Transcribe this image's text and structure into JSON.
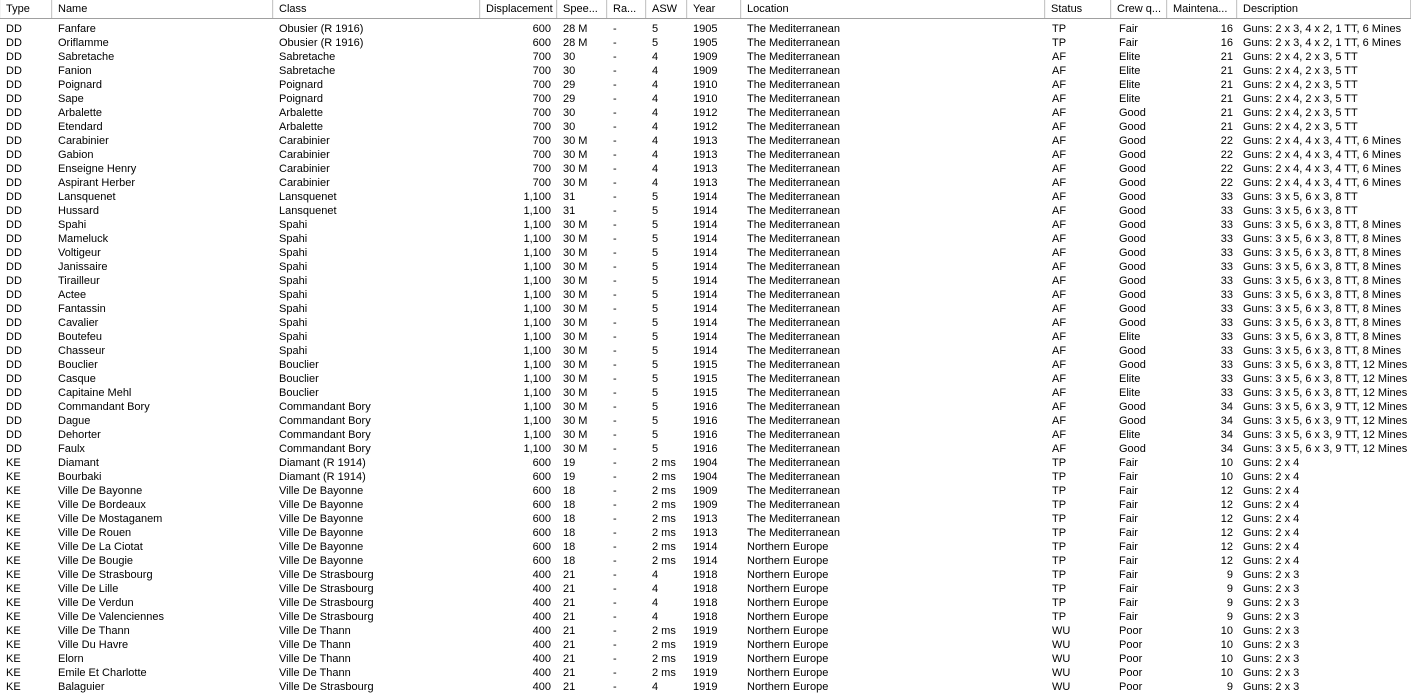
{
  "columns": [
    "Type",
    "Name",
    "Class",
    "Displacement",
    "Spee...",
    "Ra...",
    "ASW",
    "Year",
    "Location",
    "Status",
    "Crew q...",
    "Maintena...",
    "Description"
  ],
  "rows": [
    [
      "DD",
      "Fanfare",
      "Obusier (R 1916)",
      "600",
      "28 M",
      "-",
      "5",
      "1905",
      "The Mediterranean",
      "TP",
      "Fair",
      "16",
      "Guns: 2 x 3, 4 x 2, 1 TT, 6 Mines"
    ],
    [
      "DD",
      "Oriflamme",
      "Obusier (R 1916)",
      "600",
      "28 M",
      "-",
      "5",
      "1905",
      "The Mediterranean",
      "TP",
      "Fair",
      "16",
      "Guns: 2 x 3, 4 x 2, 1 TT, 6 Mines"
    ],
    [
      "DD",
      "Sabretache",
      "Sabretache",
      "700",
      "30",
      "-",
      "4",
      "1909",
      "The Mediterranean",
      "AF",
      "Elite",
      "21",
      "Guns: 2 x 4, 2 x 3, 5 TT"
    ],
    [
      "DD",
      "Fanion",
      "Sabretache",
      "700",
      "30",
      "-",
      "4",
      "1909",
      "The Mediterranean",
      "AF",
      "Elite",
      "21",
      "Guns: 2 x 4, 2 x 3, 5 TT"
    ],
    [
      "DD",
      "Poignard",
      "Poignard",
      "700",
      "29",
      "-",
      "4",
      "1910",
      "The Mediterranean",
      "AF",
      "Elite",
      "21",
      "Guns: 2 x 4, 2 x 3, 5 TT"
    ],
    [
      "DD",
      "Sape",
      "Poignard",
      "700",
      "29",
      "-",
      "4",
      "1910",
      "The Mediterranean",
      "AF",
      "Elite",
      "21",
      "Guns: 2 x 4, 2 x 3, 5 TT"
    ],
    [
      "DD",
      "Arbalette",
      "Arbalette",
      "700",
      "30",
      "-",
      "4",
      "1912",
      "The Mediterranean",
      "AF",
      "Good",
      "21",
      "Guns: 2 x 4, 2 x 3, 5 TT"
    ],
    [
      "DD",
      "Etendard",
      "Arbalette",
      "700",
      "30",
      "-",
      "4",
      "1912",
      "The Mediterranean",
      "AF",
      "Good",
      "21",
      "Guns: 2 x 4, 2 x 3, 5 TT"
    ],
    [
      "DD",
      "Carabinier",
      "Carabinier",
      "700",
      "30 M",
      "-",
      "4",
      "1913",
      "The Mediterranean",
      "AF",
      "Good",
      "22",
      "Guns: 2 x 4, 4 x 3, 4 TT, 6 Mines"
    ],
    [
      "DD",
      "Gabion",
      "Carabinier",
      "700",
      "30 M",
      "-",
      "4",
      "1913",
      "The Mediterranean",
      "AF",
      "Good",
      "22",
      "Guns: 2 x 4, 4 x 3, 4 TT, 6 Mines"
    ],
    [
      "DD",
      "Enseigne Henry",
      "Carabinier",
      "700",
      "30 M",
      "-",
      "4",
      "1913",
      "The Mediterranean",
      "AF",
      "Good",
      "22",
      "Guns: 2 x 4, 4 x 3, 4 TT, 6 Mines"
    ],
    [
      "DD",
      "Aspirant Herber",
      "Carabinier",
      "700",
      "30 M",
      "-",
      "4",
      "1913",
      "The Mediterranean",
      "AF",
      "Good",
      "22",
      "Guns: 2 x 4, 4 x 3, 4 TT, 6 Mines"
    ],
    [
      "DD",
      "Lansquenet",
      "Lansquenet",
      "1,100",
      "31",
      "-",
      "5",
      "1914",
      "The Mediterranean",
      "AF",
      "Good",
      "33",
      "Guns: 3 x 5, 6 x 3, 8 TT"
    ],
    [
      "DD",
      "Hussard",
      "Lansquenet",
      "1,100",
      "31",
      "-",
      "5",
      "1914",
      "The Mediterranean",
      "AF",
      "Good",
      "33",
      "Guns: 3 x 5, 6 x 3, 8 TT"
    ],
    [
      "DD",
      "Spahi",
      "Spahi",
      "1,100",
      "30 M",
      "-",
      "5",
      "1914",
      "The Mediterranean",
      "AF",
      "Good",
      "33",
      "Guns: 3 x 5, 6 x 3, 8 TT, 8 Mines"
    ],
    [
      "DD",
      "Mameluck",
      "Spahi",
      "1,100",
      "30 M",
      "-",
      "5",
      "1914",
      "The Mediterranean",
      "AF",
      "Good",
      "33",
      "Guns: 3 x 5, 6 x 3, 8 TT, 8 Mines"
    ],
    [
      "DD",
      "Voltigeur",
      "Spahi",
      "1,100",
      "30 M",
      "-",
      "5",
      "1914",
      "The Mediterranean",
      "AF",
      "Good",
      "33",
      "Guns: 3 x 5, 6 x 3, 8 TT, 8 Mines"
    ],
    [
      "DD",
      "Janissaire",
      "Spahi",
      "1,100",
      "30 M",
      "-",
      "5",
      "1914",
      "The Mediterranean",
      "AF",
      "Good",
      "33",
      "Guns: 3 x 5, 6 x 3, 8 TT, 8 Mines"
    ],
    [
      "DD",
      "Tirailleur",
      "Spahi",
      "1,100",
      "30 M",
      "-",
      "5",
      "1914",
      "The Mediterranean",
      "AF",
      "Good",
      "33",
      "Guns: 3 x 5, 6 x 3, 8 TT, 8 Mines"
    ],
    [
      "DD",
      "Actee",
      "Spahi",
      "1,100",
      "30 M",
      "-",
      "5",
      "1914",
      "The Mediterranean",
      "AF",
      "Good",
      "33",
      "Guns: 3 x 5, 6 x 3, 8 TT, 8 Mines"
    ],
    [
      "DD",
      "Fantassin",
      "Spahi",
      "1,100",
      "30 M",
      "-",
      "5",
      "1914",
      "The Mediterranean",
      "AF",
      "Good",
      "33",
      "Guns: 3 x 5, 6 x 3, 8 TT, 8 Mines"
    ],
    [
      "DD",
      "Cavalier",
      "Spahi",
      "1,100",
      "30 M",
      "-",
      "5",
      "1914",
      "The Mediterranean",
      "AF",
      "Good",
      "33",
      "Guns: 3 x 5, 6 x 3, 8 TT, 8 Mines"
    ],
    [
      "DD",
      "Boutefeu",
      "Spahi",
      "1,100",
      "30 M",
      "-",
      "5",
      "1914",
      "The Mediterranean",
      "AF",
      "Elite",
      "33",
      "Guns: 3 x 5, 6 x 3, 8 TT, 8 Mines"
    ],
    [
      "DD",
      "Chasseur",
      "Spahi",
      "1,100",
      "30 M",
      "-",
      "5",
      "1914",
      "The Mediterranean",
      "AF",
      "Good",
      "33",
      "Guns: 3 x 5, 6 x 3, 8 TT, 8 Mines"
    ],
    [
      "DD",
      "Bouclier",
      "Bouclier",
      "1,100",
      "30 M",
      "-",
      "5",
      "1915",
      "The Mediterranean",
      "AF",
      "Good",
      "33",
      "Guns: 3 x 5, 6 x 3, 8 TT, 12 Mines"
    ],
    [
      "DD",
      "Casque",
      "Bouclier",
      "1,100",
      "30 M",
      "-",
      "5",
      "1915",
      "The Mediterranean",
      "AF",
      "Elite",
      "33",
      "Guns: 3 x 5, 6 x 3, 8 TT, 12 Mines"
    ],
    [
      "DD",
      "Capitaine Mehl",
      "Bouclier",
      "1,100",
      "30 M",
      "-",
      "5",
      "1915",
      "The Mediterranean",
      "AF",
      "Elite",
      "33",
      "Guns: 3 x 5, 6 x 3, 8 TT, 12 Mines"
    ],
    [
      "DD",
      "Commandant Bory",
      "Commandant Bory",
      "1,100",
      "30 M",
      "-",
      "5",
      "1916",
      "The Mediterranean",
      "AF",
      "Good",
      "34",
      "Guns: 3 x 5, 6 x 3, 9 TT, 12 Mines"
    ],
    [
      "DD",
      "Dague",
      "Commandant Bory",
      "1,100",
      "30 M",
      "-",
      "5",
      "1916",
      "The Mediterranean",
      "AF",
      "Good",
      "34",
      "Guns: 3 x 5, 6 x 3, 9 TT, 12 Mines"
    ],
    [
      "DD",
      "Dehorter",
      "Commandant Bory",
      "1,100",
      "30 M",
      "-",
      "5",
      "1916",
      "The Mediterranean",
      "AF",
      "Elite",
      "34",
      "Guns: 3 x 5, 6 x 3, 9 TT, 12 Mines"
    ],
    [
      "DD",
      "Faulx",
      "Commandant Bory",
      "1,100",
      "30 M",
      "-",
      "5",
      "1916",
      "The Mediterranean",
      "AF",
      "Good",
      "34",
      "Guns: 3 x 5, 6 x 3, 9 TT, 12 Mines"
    ],
    [
      "KE",
      "Diamant",
      "Diamant (R 1914)",
      "600",
      "19",
      "-",
      "2 ms",
      "1904",
      "The Mediterranean",
      "TP",
      "Fair",
      "10",
      "Guns: 2 x 4"
    ],
    [
      "KE",
      "Bourbaki",
      "Diamant (R 1914)",
      "600",
      "19",
      "-",
      "2 ms",
      "1904",
      "The Mediterranean",
      "TP",
      "Fair",
      "10",
      "Guns: 2 x 4"
    ],
    [
      "KE",
      "Ville De Bayonne",
      "Ville De Bayonne",
      "600",
      "18",
      "-",
      "2 ms",
      "1909",
      "The Mediterranean",
      "TP",
      "Fair",
      "12",
      "Guns: 2 x 4"
    ],
    [
      "KE",
      "Ville De Bordeaux",
      "Ville De Bayonne",
      "600",
      "18",
      "-",
      "2 ms",
      "1909",
      "The Mediterranean",
      "TP",
      "Fair",
      "12",
      "Guns: 2 x 4"
    ],
    [
      "KE",
      "Ville De Mostaganem",
      "Ville De Bayonne",
      "600",
      "18",
      "-",
      "2 ms",
      "1913",
      "The Mediterranean",
      "TP",
      "Fair",
      "12",
      "Guns: 2 x 4"
    ],
    [
      "KE",
      "Ville De Rouen",
      "Ville De Bayonne",
      "600",
      "18",
      "-",
      "2 ms",
      "1913",
      "The Mediterranean",
      "TP",
      "Fair",
      "12",
      "Guns: 2 x 4"
    ],
    [
      "KE",
      "Ville De La Ciotat",
      "Ville De Bayonne",
      "600",
      "18",
      "-",
      "2 ms",
      "1914",
      "Northern Europe",
      "TP",
      "Fair",
      "12",
      "Guns: 2 x 4"
    ],
    [
      "KE",
      "Ville De Bougie",
      "Ville De Bayonne",
      "600",
      "18",
      "-",
      "2 ms",
      "1914",
      "Northern Europe",
      "TP",
      "Fair",
      "12",
      "Guns: 2 x 4"
    ],
    [
      "KE",
      "Ville De Strasbourg",
      "Ville De Strasbourg",
      "400",
      "21",
      "-",
      "4",
      "1918",
      "Northern Europe",
      "TP",
      "Fair",
      "9",
      "Guns: 2 x 3"
    ],
    [
      "KE",
      "Ville De Lille",
      "Ville De Strasbourg",
      "400",
      "21",
      "-",
      "4",
      "1918",
      "Northern Europe",
      "TP",
      "Fair",
      "9",
      "Guns: 2 x 3"
    ],
    [
      "KE",
      "Ville De Verdun",
      "Ville De Strasbourg",
      "400",
      "21",
      "-",
      "4",
      "1918",
      "Northern Europe",
      "TP",
      "Fair",
      "9",
      "Guns: 2 x 3"
    ],
    [
      "KE",
      "Ville De Valenciennes",
      "Ville De Strasbourg",
      "400",
      "21",
      "-",
      "4",
      "1918",
      "Northern Europe",
      "TP",
      "Fair",
      "9",
      "Guns: 2 x 3"
    ],
    [
      "KE",
      "Ville De Thann",
      "Ville De Thann",
      "400",
      "21",
      "-",
      "2 ms",
      "1919",
      "Northern Europe",
      "WU",
      "Poor",
      "10",
      "Guns: 2 x 3"
    ],
    [
      "KE",
      "Ville Du Havre",
      "Ville De Thann",
      "400",
      "21",
      "-",
      "2 ms",
      "1919",
      "Northern Europe",
      "WU",
      "Poor",
      "10",
      "Guns: 2 x 3"
    ],
    [
      "KE",
      "Elorn",
      "Ville De Thann",
      "400",
      "21",
      "-",
      "2 ms",
      "1919",
      "Northern Europe",
      "WU",
      "Poor",
      "10",
      "Guns: 2 x 3"
    ],
    [
      "KE",
      "Emile Et Charlotte",
      "Ville De Thann",
      "400",
      "21",
      "-",
      "2 ms",
      "1919",
      "Northern Europe",
      "WU",
      "Poor",
      "10",
      "Guns: 2 x 3"
    ],
    [
      "KE",
      "Balaguier",
      "Ville De Strasbourg",
      "400",
      "21",
      "-",
      "4",
      "1919",
      "Northern Europe",
      "WU",
      "Poor",
      "9",
      "Guns: 2 x 3"
    ]
  ]
}
